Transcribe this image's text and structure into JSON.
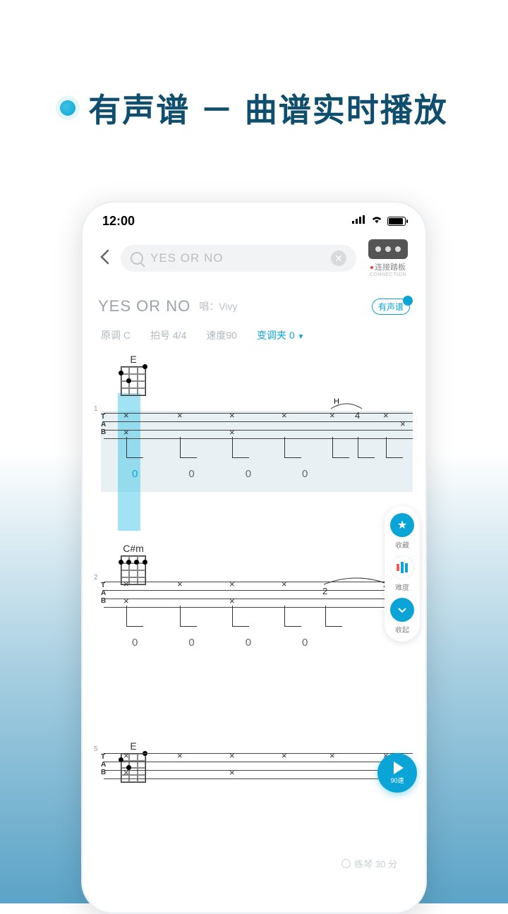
{
  "page_heading": "有声谱 － 曲谱实时播放",
  "status": {
    "time": "12:00"
  },
  "search": {
    "value": "YES OR NO"
  },
  "pedal": {
    "label": "连接踏板",
    "sub": "CONNECTION"
  },
  "song": {
    "title": "YES OR NO",
    "singer_prefix": "唱：",
    "singer": "Vivy",
    "badge": "有声谱"
  },
  "meta": {
    "key": "原调 C",
    "time_sig": "拍号 4/4",
    "tempo": "速度90",
    "capo": "变调夹 0"
  },
  "chords": {
    "c1": "E",
    "c2": "C#m",
    "c3": "E"
  },
  "tab_numbers": {
    "b1": "1",
    "b2": "2",
    "b3": "5"
  },
  "nums": [
    "0",
    "0",
    "0",
    "0"
  ],
  "side": {
    "fav": "收藏",
    "diff": "难度",
    "collapse": "收起"
  },
  "play": {
    "speed": "90速"
  },
  "footer": {
    "practice": "练琴 30 分"
  },
  "notation": {
    "h": "H",
    "four": "4",
    "two": "2"
  }
}
